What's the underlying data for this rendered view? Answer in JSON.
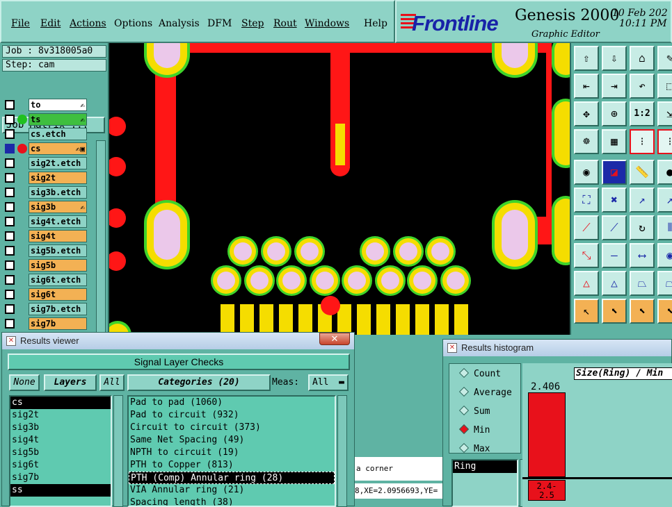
{
  "menu": {
    "items": [
      "File",
      "Edit",
      "Actions",
      "Options",
      "Analysis",
      "DFM",
      "Step",
      "Rout",
      "Windows",
      "Help"
    ]
  },
  "header": {
    "brand": "Frontline",
    "product": "Genesis 2000",
    "subtitle": "Graphic Editor",
    "date": "10 Feb 202",
    "time": "10:11 PM"
  },
  "job": {
    "job_label": "Job : 8v318005a0",
    "step_label": "Step: cam",
    "matrix_button": "Job Matrix ..."
  },
  "layers": [
    {
      "name": "to",
      "color": "#ffffff",
      "checkbox": "white",
      "dot": "",
      "mark": "✍"
    },
    {
      "name": "ts",
      "color": "#3fbf3f",
      "checkbox": "white",
      "dot": "#20c020",
      "mark": "✍"
    },
    {
      "name": "cs.etch",
      "color": "#8ed3c6",
      "checkbox": "white",
      "dot": "",
      "mark": ""
    },
    {
      "name": "cs",
      "color": "#f3b154",
      "checkbox": "blue",
      "dot": "#e8111b",
      "mark": "✍▣"
    },
    {
      "name": "sig2t.etch",
      "color": "#8ed3c6",
      "checkbox": "white",
      "dot": "",
      "mark": ""
    },
    {
      "name": "sig2t",
      "color": "#f3b154",
      "checkbox": "white",
      "dot": "",
      "mark": ""
    },
    {
      "name": "sig3b.etch",
      "color": "#8ed3c6",
      "checkbox": "white",
      "dot": "",
      "mark": ""
    },
    {
      "name": "sig3b",
      "color": "#f3b154",
      "checkbox": "white",
      "dot": "",
      "mark": "✍"
    },
    {
      "name": "sig4t.etch",
      "color": "#8ed3c6",
      "checkbox": "white",
      "dot": "",
      "mark": ""
    },
    {
      "name": "sig4t",
      "color": "#f3b154",
      "checkbox": "white",
      "dot": "",
      "mark": ""
    },
    {
      "name": "sig5b.etch",
      "color": "#8ed3c6",
      "checkbox": "white",
      "dot": "",
      "mark": ""
    },
    {
      "name": "sig5b",
      "color": "#f3b154",
      "checkbox": "white",
      "dot": "",
      "mark": ""
    },
    {
      "name": "sig6t.etch",
      "color": "#8ed3c6",
      "checkbox": "white",
      "dot": "",
      "mark": ""
    },
    {
      "name": "sig6t",
      "color": "#f3b154",
      "checkbox": "white",
      "dot": "",
      "mark": ""
    },
    {
      "name": "sig7b.etch",
      "color": "#8ed3c6",
      "checkbox": "white",
      "dot": "",
      "mark": ""
    },
    {
      "name": "sig7b",
      "color": "#f3b154",
      "checkbox": "white",
      "dot": "",
      "mark": ""
    }
  ],
  "results_viewer": {
    "title": "Results viewer",
    "header": "Signal Layer Checks",
    "none_btn": "None",
    "layers_btn": "Layers",
    "all_btn": "All",
    "categories_btn": "Categories (20)",
    "meas_label": "Meas:",
    "meas_value": "All",
    "layer_list": [
      {
        "name": "cs",
        "selected": true
      },
      {
        "name": "sig2t",
        "selected": false
      },
      {
        "name": "sig3b",
        "selected": false
      },
      {
        "name": "sig4t",
        "selected": false
      },
      {
        "name": "sig5b",
        "selected": false
      },
      {
        "name": "sig6t",
        "selected": false
      },
      {
        "name": "sig7b",
        "selected": false
      },
      {
        "name": "ss",
        "selected": true
      }
    ],
    "categories": [
      {
        "name": "Pad to pad (1060)",
        "current": false
      },
      {
        "name": "Pad to circuit (932)",
        "current": false
      },
      {
        "name": "Circuit to circuit (373)",
        "current": false
      },
      {
        "name": "Same Net Spacing (49)",
        "current": false
      },
      {
        "name": "NPTH to circuit (19)",
        "current": false
      },
      {
        "name": "PTH to Copper (813)",
        "current": false
      },
      {
        "name": "PTH (Comp) Annular ring (28)",
        "current": true
      },
      {
        "name": "VIA Annular ring (21)",
        "current": false
      },
      {
        "name": "Spacing length (38)",
        "current": false
      }
    ]
  },
  "status": {
    "line1": "a corner",
    "line2": "8,XE=2.0956693,YE="
  },
  "histogram": {
    "title": "Results histogram",
    "modes": [
      {
        "label": "Count",
        "on": false
      },
      {
        "label": "Average",
        "on": false
      },
      {
        "label": "Sum",
        "on": false
      },
      {
        "label": "Min",
        "on": true
      },
      {
        "label": "Max",
        "on": false
      }
    ],
    "field": "Ring",
    "chart_title": "Size(Ring) / Min",
    "bar_value": "2.406",
    "bar_range": "2.4- 2.5"
  }
}
